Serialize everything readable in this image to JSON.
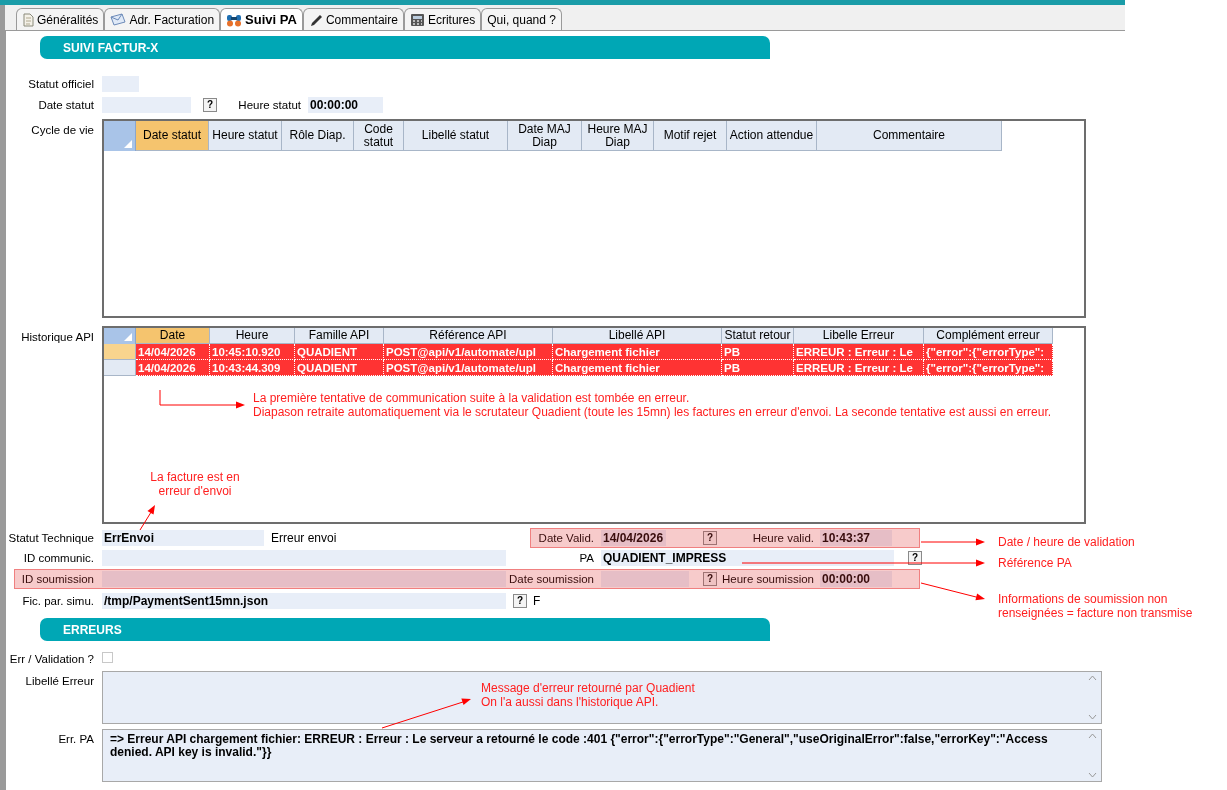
{
  "tabs": [
    {
      "label": "Généralités",
      "selected": false
    },
    {
      "label": "Adr. Facturation",
      "selected": false
    },
    {
      "label": "Suivi PA",
      "selected": true
    },
    {
      "label": "Commentaire",
      "selected": false
    },
    {
      "label": "Ecritures",
      "selected": false
    },
    {
      "label": "Qui, quand ?",
      "selected": false
    }
  ],
  "suivi_section": {
    "title": "SUIVI FACTUR-X"
  },
  "statut_officiel": {
    "label": "Statut officiel"
  },
  "date_statut": {
    "label": "Date statut",
    "help": "?"
  },
  "heure_statut": {
    "label": "Heure statut",
    "value": "00:00:00"
  },
  "cycle_de_vie": {
    "label": "Cycle de vie",
    "columns": [
      {
        "label": "Date statut",
        "selected": true
      },
      {
        "label": "Heure statut",
        "selected": false
      },
      {
        "label": "Rôle Diap.",
        "selected": false
      },
      {
        "label": "Code statut",
        "selected": false
      },
      {
        "label": "Libellé statut",
        "selected": false
      },
      {
        "label": "Date MAJ Diap",
        "selected": false
      },
      {
        "label": "Heure MAJ Diap",
        "selected": false
      },
      {
        "label": "Motif rejet",
        "selected": false
      },
      {
        "label": "Action attendue",
        "selected": false
      },
      {
        "label": "Commentaire",
        "selected": false
      }
    ]
  },
  "historique_api": {
    "label": "Historique API",
    "columns": [
      {
        "label": "Date",
        "selected": true
      },
      {
        "label": "Heure",
        "selected": false
      },
      {
        "label": "Famille API",
        "selected": false
      },
      {
        "label": "Référence API",
        "selected": false
      },
      {
        "label": "Libellé API",
        "selected": false
      },
      {
        "label": "Statut retour",
        "selected": false
      },
      {
        "label": "Libelle Erreur",
        "selected": false
      },
      {
        "label": "Complément erreur",
        "selected": false
      }
    ],
    "rows": [
      {
        "selected": true,
        "cells": [
          "14/04/2026",
          "10:45:10.920",
          "QUADIENT",
          "POST@api/v1/automate/upl",
          "Chargement fichier",
          "PB",
          "ERREUR : Erreur : Le",
          "{\"error\":{\"errorType\":"
        ]
      },
      {
        "selected": false,
        "cells": [
          "14/04/2026",
          "10:43:44.309",
          "QUADIENT",
          "POST@api/v1/automate/upl",
          "Chargement fichier",
          "PB",
          "ERREUR : Erreur : Le",
          "{\"error\":{\"errorType\":"
        ]
      }
    ]
  },
  "statut_technique": {
    "label": "Statut Technique",
    "value": "ErrEnvoi",
    "description": "Erreur envoi"
  },
  "date_valid": {
    "label": "Date Valid.",
    "value": "14/04/2026",
    "help": "?"
  },
  "heure_valid": {
    "label": "Heure valid.",
    "value": "10:43:37"
  },
  "id_communic": {
    "label": "ID communic."
  },
  "pa": {
    "label": "PA",
    "value": "QUADIENT_IMPRESS",
    "help": "?"
  },
  "id_soumission": {
    "label": "ID soumission"
  },
  "date_soumission": {
    "label": "Date soumission",
    "help": "?"
  },
  "heure_soumission": {
    "label": "Heure soumission",
    "value": "00:00:00"
  },
  "fic_par_simu": {
    "label": "Fic. par. simu.",
    "value": "/tmp/PaymentSent15mn.json",
    "help": "?",
    "flag": "F"
  },
  "erreurs_section": {
    "title": "ERREURS"
  },
  "err_validation": {
    "label": "Err / Validation ?",
    "checked": false
  },
  "libelle_erreur": {
    "label": "Libellé Erreur"
  },
  "err_pa": {
    "label": "Err. PA",
    "value": "=> Erreur API chargement fichier: ERREUR : Erreur : Le serveur a retourné le code :401 {\"error\":{\"errorType\":\"General\",\"useOriginalError\":false,\"errorKey\":\"Access denied. API key is invalid.\"}}"
  },
  "annotations": [
    {
      "lines": [
        "La première tentative de communication suite à la validation est tombée en erreur.",
        "Diapason retraite automatiquement via le scrutateur Quadient (toute les 15mn) les factures en erreur d'envoi. La seconde tentative est aussi en erreur."
      ]
    },
    {
      "lines": [
        "La facture est en",
        "erreur d'envoi"
      ]
    },
    {
      "lines": [
        "Date / heure de validation"
      ]
    },
    {
      "lines": [
        "Référence PA"
      ]
    },
    {
      "lines": [
        "Informations de soumission non",
        "renseignées = facture non transmise"
      ]
    },
    {
      "lines": [
        "Message d'erreur retourné par Quadient",
        "On l'a aussi dans l'historique API."
      ]
    }
  ]
}
